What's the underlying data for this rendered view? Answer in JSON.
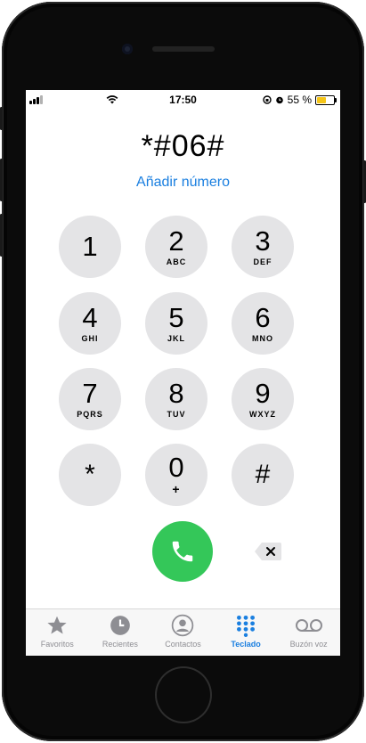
{
  "status_bar": {
    "time": "17:50",
    "battery_text": "55 %",
    "battery_level": 0.55
  },
  "dialer": {
    "number": "*#06#",
    "add_number": "Añadir número",
    "keys": [
      {
        "digit": "1",
        "letters": ""
      },
      {
        "digit": "2",
        "letters": "ABC"
      },
      {
        "digit": "3",
        "letters": "DEF"
      },
      {
        "digit": "4",
        "letters": "GHI"
      },
      {
        "digit": "5",
        "letters": "JKL"
      },
      {
        "digit": "6",
        "letters": "MNO"
      },
      {
        "digit": "7",
        "letters": "PQRS"
      },
      {
        "digit": "8",
        "letters": "TUV"
      },
      {
        "digit": "9",
        "letters": "WXYZ"
      },
      {
        "digit": "*",
        "letters": ""
      },
      {
        "digit": "0",
        "letters": "+"
      },
      {
        "digit": "#",
        "letters": ""
      }
    ]
  },
  "tabs": [
    {
      "label": "Favoritos",
      "icon": "star-icon",
      "active": false
    },
    {
      "label": "Recientes",
      "icon": "clock-icon",
      "active": false
    },
    {
      "label": "Contactos",
      "icon": "person-icon",
      "active": false
    },
    {
      "label": "Teclado",
      "icon": "keypad-icon",
      "active": true
    },
    {
      "label": "Buzón voz",
      "icon": "voicemail-icon",
      "active": false
    }
  ],
  "colors": {
    "accent": "#1a7fe0",
    "call": "#34c759",
    "key": "#e4e4e6",
    "battery": "#f5c518"
  }
}
